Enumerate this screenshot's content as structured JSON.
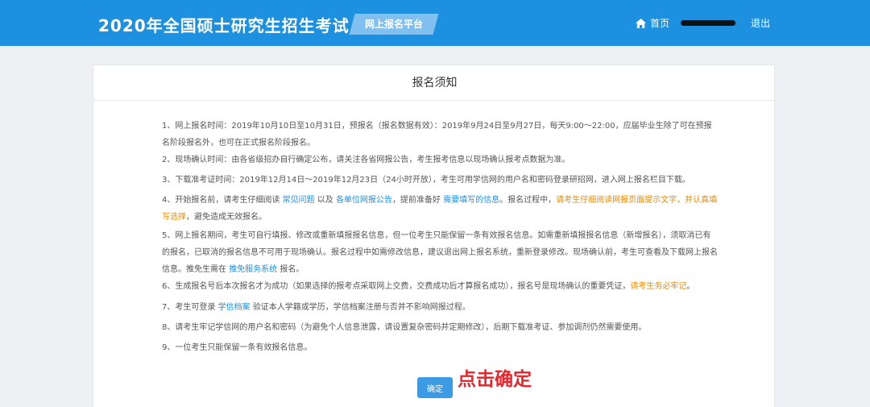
{
  "header": {
    "title": "2020年全国硕士研究生招生考试",
    "platform": "网上报名平台",
    "home": "首页",
    "logout": "退出"
  },
  "panel": {
    "title": "报名须知"
  },
  "notices": {
    "n1": "1、网上报名时间：2019年10月10日至10月31日，预报名（报名数据有效）：2019年9月24日至9月27日，每天9:00～22:00，应届毕业生除了可在预报名阶段报名外，也可在正式报名阶段报名。",
    "n2": "2、现场确认时间：由各省级招办自行确定公布，请关注各省网报公告，考生报考信息以现场确认报考点数据为准。",
    "n3": "3、下载准考证时间：2019年12月14日～2019年12月23日（24小时开放），考生可用学信网的用户名和密码登录研招网，进入网上报名栏目下载。",
    "n4": {
      "a": "4、开始报名前，请考生仔细阅读",
      "faq": "常见问题",
      "b": "以及",
      "unit_notice": "各单位网报公告",
      "c": "，提前准备好",
      "info_needed": "需要填写的信息",
      "d": "。报名过程中，",
      "warn": "请考生仔细阅读网报页面提示文字，并认真填写选择",
      "e": "，避免造成无效报名。"
    },
    "n5": {
      "a": "5、网上报名期间，考生可自行填报、修改或重新填报报名信息，但一位考生只能保留一条有效报名信息。如需重新填报报名信息（新增报名），须取消已有的报名，已取消的报名信息不可用于现场确认。报名过程中如需修改信息，建议退出网上报名系统，重新登录修改。现场确认前，考生可查看及下载网上报名信息。推免生需在",
      "link": "推免服务系统",
      "b": "报名。"
    },
    "n6": {
      "a": "6、生成报名号后本次报名才为成功（如果选择的报考点采取网上交费，交费成功后才算报名成功），报名号是现场确认的重要凭证，",
      "warn": "请考生务必牢记",
      "b": "。"
    },
    "n7": {
      "a": "7、考生可登录",
      "link": "学信档案",
      "b": "验证本人学籍或学历，学信档案注册与否并不影响网报过程。"
    },
    "n8": "8、请考生牢记学信网的用户名和密码（为避免个人信息泄露，请设置复杂密码并定期修改），后期下载准考证、参加调剂仍然需要使用。",
    "n9": "9、一位考生只能保留一条有效报名信息。"
  },
  "confirm_button": "确定",
  "annotation": "点击确定",
  "colors": {
    "header": "#1e90e0",
    "link": "#1e90e0",
    "warning": "#e58d0c",
    "annotation": "#e8252b",
    "button": "#3d9be6"
  },
  "icons": {
    "home": "home-icon"
  }
}
